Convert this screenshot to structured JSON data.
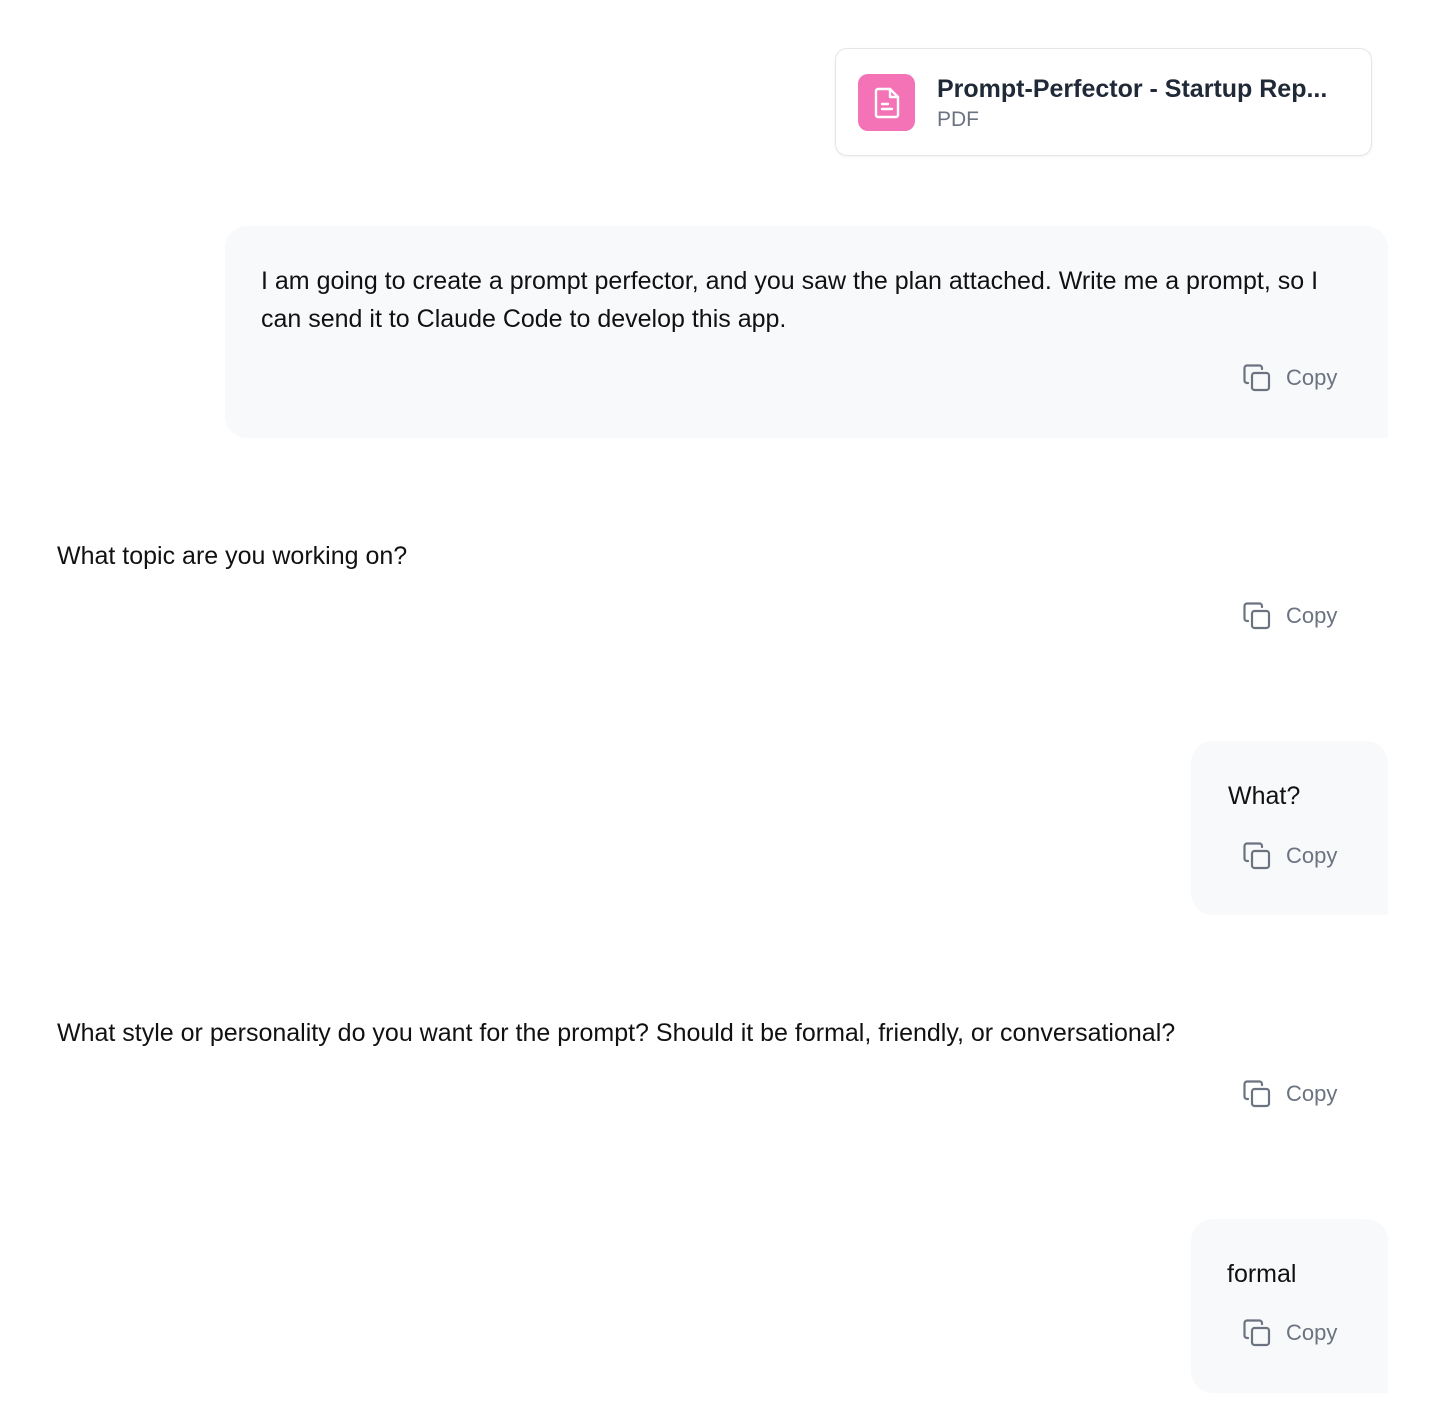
{
  "attachment": {
    "file_name": "Prompt-Perfector - Startup Rep...",
    "file_type": "PDF",
    "icon": "document-icon",
    "icon_color": "#f472b6"
  },
  "messages": [
    {
      "role": "user",
      "text": "I am going to create a prompt perfector, and you saw the plan attached. Write me a prompt, so I can send it to Claude Code to develop this app.",
      "copy_label": "Copy"
    },
    {
      "role": "assistant",
      "text": "What topic are you working on?",
      "copy_label": "Copy"
    },
    {
      "role": "user",
      "text": "What?",
      "copy_label": "Copy"
    },
    {
      "role": "assistant",
      "text": "What style or personality do you want for the prompt? Should it be formal, friendly, or conversational?",
      "copy_label": "Copy"
    },
    {
      "role": "user",
      "text": "formal",
      "copy_label": "Copy"
    }
  ],
  "colors": {
    "user_bubble_bg": "#f8f9fb",
    "muted_text": "#6b7280"
  }
}
